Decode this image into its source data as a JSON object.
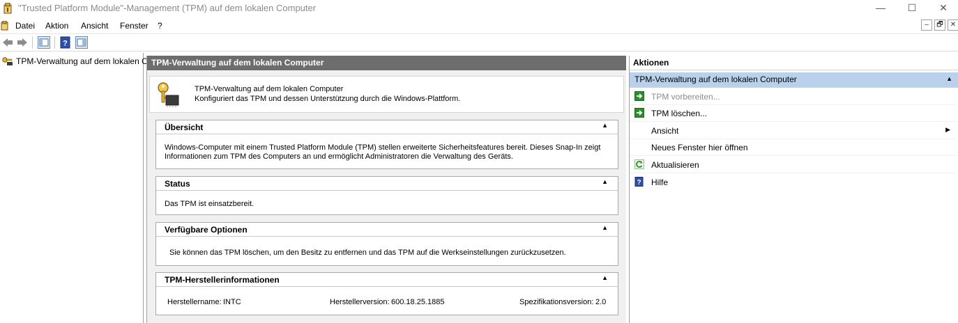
{
  "window": {
    "title": "\"Trusted Platform Module\"-Management (TPM) auf dem lokalen Computer",
    "minimize": "—",
    "maximize": "☐",
    "close": "✕"
  },
  "menu": {
    "items": [
      "Datei",
      "Aktion",
      "Ansicht",
      "Fenster",
      "?"
    ],
    "mdi_min": "–",
    "mdi_restore": "🗗",
    "mdi_close": "✕"
  },
  "tree": {
    "root_label": "TPM-Verwaltung auf dem lokalen C"
  },
  "center": {
    "header": "TPM-Verwaltung auf dem lokalen Computer",
    "intro_title": "TPM-Verwaltung auf dem lokalen Computer",
    "intro_desc": "Konfiguriert das TPM und dessen Unterstützung durch die Windows-Plattform.",
    "sections": {
      "overview": {
        "title": "Übersicht",
        "text1": "Windows-Computer mit einem Trusted Platform Module (TPM) stellen erweiterte Sicherheitsfeatures bereit. Dieses Snap-In zeigt",
        "text2": "Informationen zum TPM des Computers an und ermöglicht Administratoren die Verwaltung des Geräts."
      },
      "status": {
        "title": "Status",
        "text": "Das TPM ist einsatzbereit."
      },
      "options": {
        "title": "Verfügbare Optionen",
        "text": "Sie können das TPM löschen, um den Besitz zu entfernen und das TPM auf die Werkseinstellungen zurückzusetzen."
      },
      "manufacturer": {
        "title": "TPM-Herstellerinformationen",
        "name_label": "Herstellername:",
        "name_value": "INTC",
        "version_label": "Herstellerversion:",
        "version_value": "600.18.25.1885",
        "spec_label": "Spezifikationsversion:",
        "spec_value": "2.0"
      }
    },
    "collapse_glyph": "▲"
  },
  "actions": {
    "header": "Aktionen",
    "group": "TPM-Verwaltung auf dem lokalen Computer",
    "items": [
      {
        "label": "TPM vorbereiten...",
        "icon": "green-arrow-icon",
        "enabled": false
      },
      {
        "label": "TPM löschen...",
        "icon": "green-arrow-icon",
        "enabled": true
      },
      {
        "label": "Ansicht",
        "icon": "",
        "enabled": true
      },
      {
        "label": "Neues Fenster hier öffnen",
        "icon": "",
        "enabled": true
      },
      {
        "label": "Aktualisieren",
        "icon": "refresh-icon",
        "enabled": true
      },
      {
        "label": "Hilfe",
        "icon": "help-icon",
        "enabled": true
      }
    ],
    "submenu_glyph": "▶"
  }
}
